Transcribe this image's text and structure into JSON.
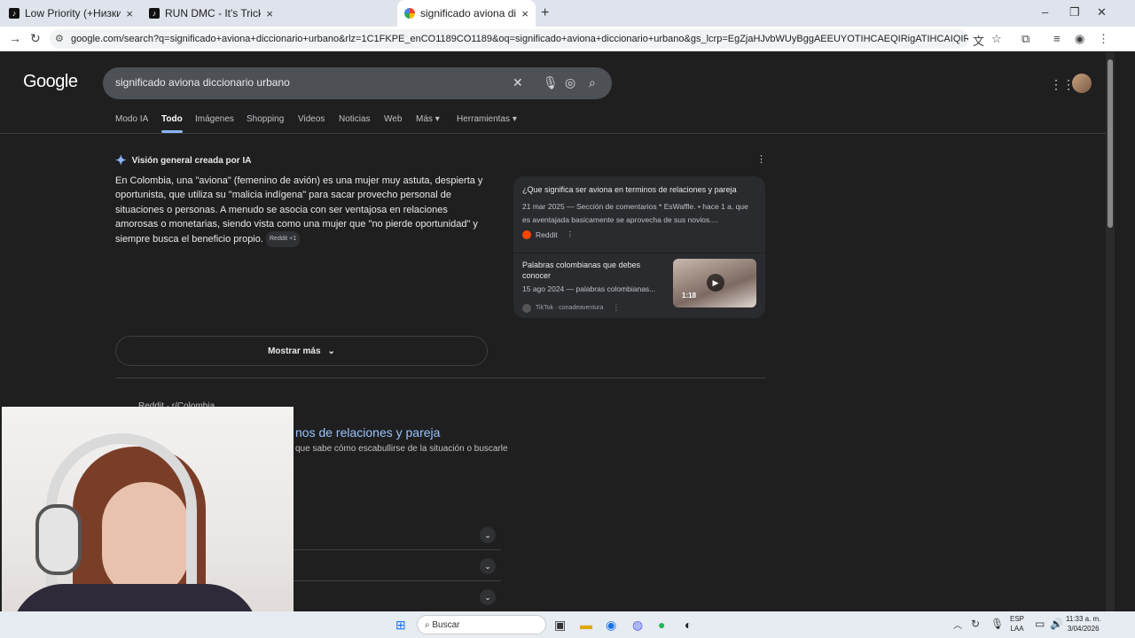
{
  "browser": {
    "tabs": [
      {
        "title": "Low Priority (+Низкий приори",
        "favicon": "tiktok-icon",
        "active": false
      },
      {
        "title": "RUN DMC - It's Tricky #rundm",
        "favicon": "tiktok-icon",
        "active": false
      },
      {
        "title": "significado aviona diccionario u",
        "favicon": "google-icon",
        "active": true
      }
    ],
    "url": "google.com/search?q=significado+aviona+diccionario+urbano&rlz=1C1FKPE_enCO1189CO1189&oq=significado+aviona+diccionario+urbano&gs_lcrp=EgZjaHJvbWUyBggAEEUYOTIHCAEQIRigATIHCAIQIRiPAjIHCAMQIRiPAtIBCDg5NjFqMGo3..."
  },
  "google": {
    "logo": "Google",
    "query": "significado aviona diccionario urbano",
    "tabs": [
      "Modo IA",
      "Todo",
      "Imágenes",
      "Shopping",
      "Videos",
      "Noticias",
      "Web",
      "Más",
      "Herramientas"
    ],
    "ai": {
      "heading": "Visión general creada por IA",
      "body": "En Colombia, una \"aviona\" (femenino de avión) es una mujer muy astuta, despierta y oportunista, que utiliza su \"malicia indígena\" para sacar provecho personal de situaciones o personas. A menudo se asocia con ser ventajosa en relaciones amorosas o monetarias, siendo vista como una mujer que \"no pierde oportunidad\" y siempre busca el beneficio propio.",
      "chip": "Reddit +1",
      "more": "Mostrar más"
    },
    "sources": [
      {
        "title": "¿Que significa ser aviona en terminos de relaciones y pareja",
        "snippet": "21 mar 2025 — Sección de comentarios * EsWaffle. • hace 1 a. que es aventajada basicamente se aprovecha de sus novios....",
        "site": "Reddit"
      },
      {
        "title": "Palabras colombianas que debes conocer",
        "snippet": "15 ago 2024 — palabras colombianas...",
        "site": "TikTok · conadeaventura",
        "duration": "1:18"
      }
    ],
    "result": {
      "site": "Reddit · r/Colombia",
      "title": "nos de relaciones y pareja",
      "snippet": "que sabe cómo escabullirse de la situación o buscarle"
    }
  },
  "taskbar": {
    "search": "Buscar",
    "lang": [
      "ESP",
      "LAA"
    ],
    "time": "11:33 a. m.",
    "date": "3/04/2026"
  }
}
